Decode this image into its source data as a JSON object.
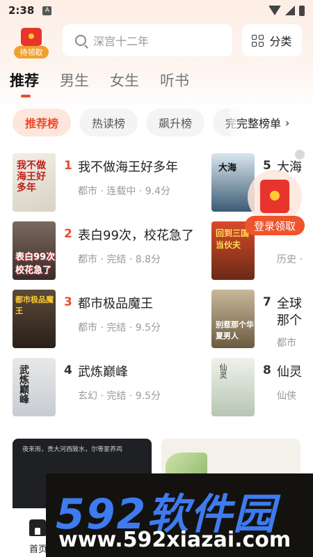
{
  "status": {
    "time": "2:38",
    "notif_badge": "A"
  },
  "header": {
    "gift_label": "待领取",
    "search_placeholder": "深宫十二年",
    "category_label": "分类"
  },
  "tabs": [
    {
      "label": "推荐",
      "active": true
    },
    {
      "label": "男生",
      "active": false
    },
    {
      "label": "女生",
      "active": false
    },
    {
      "label": "听书",
      "active": false
    }
  ],
  "chips": [
    {
      "label": "推荐榜",
      "active": true
    },
    {
      "label": "热读榜",
      "active": false
    },
    {
      "label": "飙升榜",
      "active": false
    },
    {
      "label": "完",
      "active": false
    }
  ],
  "full_rank_label": "完整榜单",
  "books": [
    {
      "rank": "1",
      "title": "我不做海王好多年",
      "meta": "都市 · 连载中 · 9.4分",
      "cover_text": "我不做海王好多年"
    },
    {
      "rank": "2",
      "title": "表白99次，校花急了",
      "meta": "都市 · 完结 · 8.8分",
      "cover_text": "表白99次校花急了"
    },
    {
      "rank": "3",
      "title": "都市极品魔王",
      "meta": "都市 · 完结 · 9.5分",
      "cover_text": "都市极品魔王"
    },
    {
      "rank": "4",
      "title": "武炼巅峰",
      "meta": "玄幻 · 完结 · 9.5分",
      "cover_text": "武炼巅峰"
    },
    {
      "rank": "5",
      "title": "大海",
      "meta": "",
      "cover_text": "大海"
    },
    {
      "rank": "",
      "title": "",
      "meta": "历史 ·",
      "cover_text": "回到三国当伙夫"
    },
    {
      "rank": "7",
      "title": "全球",
      "title2": "那个",
      "meta": "都市",
      "cover_text": "别惹那个华夏男人"
    },
    {
      "rank": "8",
      "title": "仙灵",
      "meta": "仙侠",
      "cover_text": "仙灵"
    }
  ],
  "promo": {
    "label": "登录领取"
  },
  "banner1_text": "夜来雨，贵大河西陂水，尔等家养鸡",
  "bottom_nav": {
    "home_label": "首页"
  },
  "watermark": {
    "big": "592软件园",
    "url": "www.592xiazai.com"
  },
  "colors": {
    "accent": "#f04a2a",
    "rank_red": "#e84b2a",
    "promo_red": "#e8342c"
  }
}
